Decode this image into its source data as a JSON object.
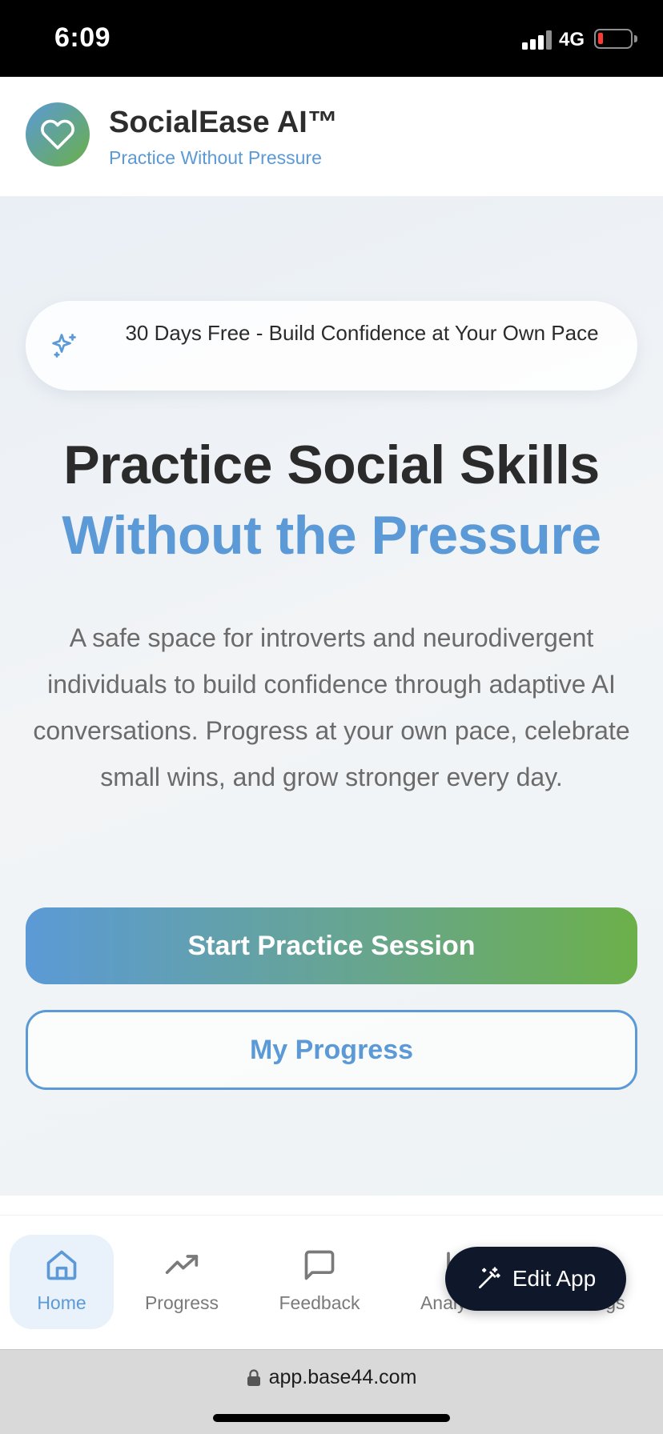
{
  "status_bar": {
    "time": "6:09",
    "network": "4G",
    "battery_level": 0.08
  },
  "header": {
    "logo_icon": "heart-icon",
    "title": "SocialEase AI™",
    "subtitle": "Practice Without Pressure"
  },
  "hero": {
    "promo_icon": "sparkles-icon",
    "promo_text": "30 Days Free - Build Confidence at Your Own Pace",
    "headline_line1": "Practice Social Skills",
    "headline_line2": "Without the Pressure",
    "description": "A safe space for introverts and neurodivergent individuals to build confidence through adaptive AI conversations. Progress at your own pace, celebrate small wins, and grow stronger every day.",
    "primary_button": "Start Practice Session",
    "secondary_button": "My Progress"
  },
  "nav": {
    "items": [
      {
        "label": "Home",
        "icon": "home-icon",
        "active": true
      },
      {
        "label": "Progress",
        "icon": "trending-up-icon",
        "active": false
      },
      {
        "label": "Feedback",
        "icon": "message-square-icon",
        "active": false
      },
      {
        "label": "Analytics",
        "icon": "bar-chart-icon",
        "active": false
      },
      {
        "label": "Settings",
        "icon": "settings-icon",
        "active": false
      }
    ]
  },
  "edit_app": {
    "label": "Edit App",
    "icon": "magic-wand-icon"
  },
  "browser": {
    "url": "app.base44.com",
    "lock_icon": "lock-icon"
  },
  "colors": {
    "accent_blue": "#5b9ad6",
    "accent_green": "#6cb04a",
    "dark": "#0f172a"
  }
}
